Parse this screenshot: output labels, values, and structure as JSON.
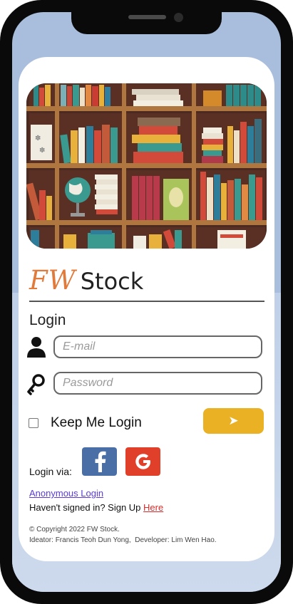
{
  "app": {
    "logo_fw": "FW",
    "logo_stock": "Stock"
  },
  "login": {
    "title": "Login",
    "email_placeholder": "E-mail",
    "password_placeholder": "Password",
    "remember_label": "Keep Me Login",
    "remember_checked": false,
    "submit_glyph": "➤",
    "login_via_label": "Login via:",
    "social": [
      {
        "name": "facebook",
        "glyph": "f",
        "color": "#4a6ea6"
      },
      {
        "name": "google",
        "glyph": "G",
        "color": "#e0402a"
      }
    ],
    "anonymous_link": "Anonymous Login",
    "signup_text": "Haven't signed in? Sign Up ",
    "signup_link": "Here",
    "copyright": "© Copyright 2022 FW Stock.",
    "credits": "Ideator: Francis Teoh Dun Yong,  Developer: Lim Wen Hao."
  },
  "colors": {
    "accent_orange": "#e07b3c",
    "submit_yellow": "#e9b123",
    "link_purple": "#5b3ad6",
    "link_red": "#d92d2d",
    "screen_blue": "#a9bedd"
  },
  "icons": {
    "user": "user-icon",
    "key": "key-icon",
    "submit": "arrow-right-icon",
    "facebook": "facebook-icon",
    "google": "google-icon"
  }
}
